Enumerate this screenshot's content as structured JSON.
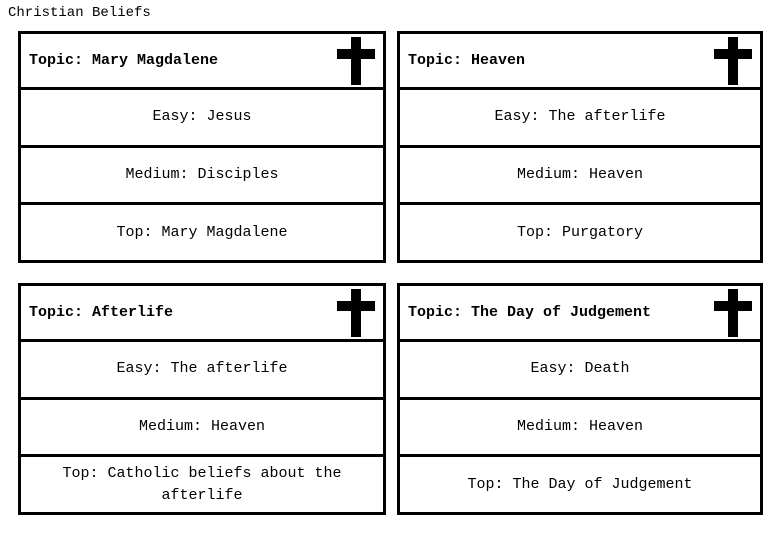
{
  "page": {
    "title": "Christian Beliefs",
    "background_color": "#ffffff",
    "text_color": "#000000",
    "border_color": "#000000"
  },
  "icon": {
    "name": "latin-cross-icon",
    "color": "#000000"
  },
  "labels": {
    "topic_prefix": "Topic:",
    "easy_prefix": "Easy:",
    "medium_prefix": "Medium:",
    "top_prefix": "Top:"
  },
  "cards": [
    {
      "topic": "Topic: Mary Magdalene",
      "easy": "Easy: Jesus",
      "medium": "Medium: Disciples",
      "top": "Top: Mary Magdalene"
    },
    {
      "topic": "Topic: Heaven",
      "easy": "Easy: The afterlife",
      "medium": "Medium: Heaven",
      "top": "Top: Purgatory"
    },
    {
      "topic": "Topic: Afterlife",
      "easy": "Easy: The afterlife",
      "medium": "Medium: Heaven",
      "top": "Top: Catholic beliefs about the afterlife"
    },
    {
      "topic": "Topic: The Day of Judgement",
      "easy": "Easy: Death",
      "medium": "Medium: Heaven",
      "top": "Top: The Day of Judgement"
    }
  ]
}
